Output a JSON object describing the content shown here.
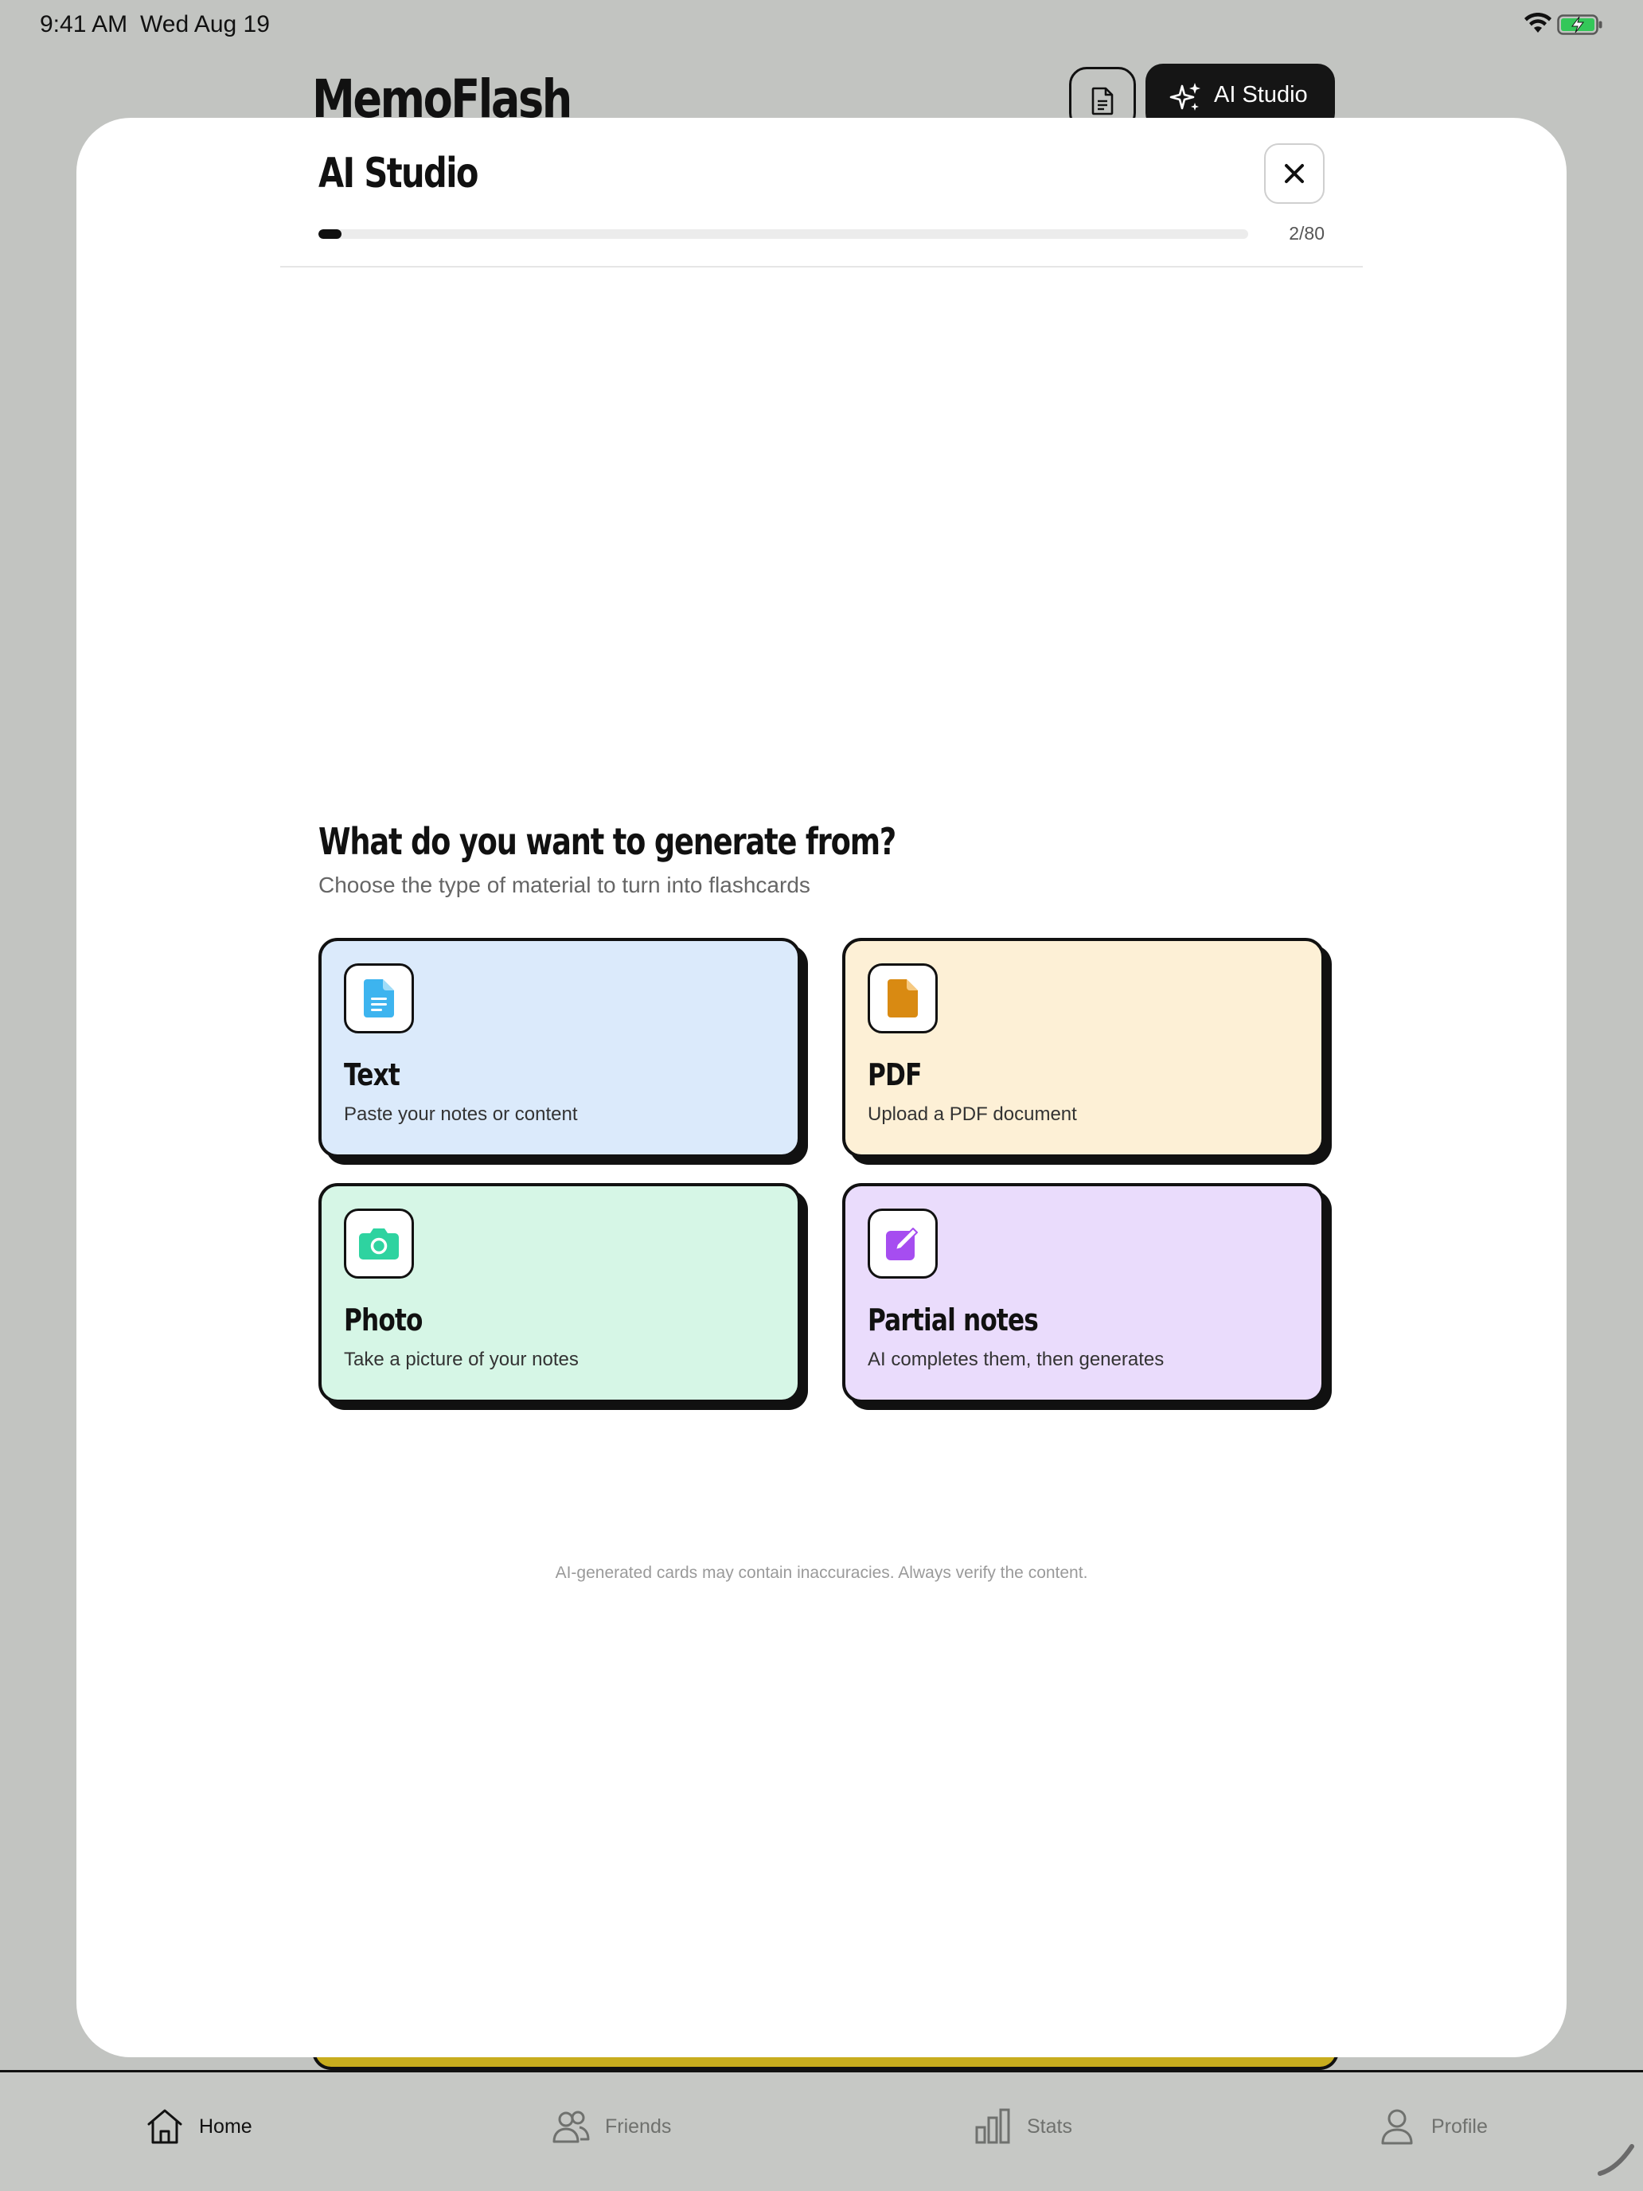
{
  "status_bar": {
    "time": "9:41 AM",
    "date": "Wed Aug 19",
    "wifi_icon": "wifi-icon",
    "battery_icon": "battery-charging-icon",
    "battery_color": "#34c759"
  },
  "header": {
    "app_title": "MemoFlash",
    "notes_icon": "document-icon",
    "ai_studio_label": "AI Studio",
    "ai_studio_icon": "sparkles-icon"
  },
  "modal": {
    "title": "AI Studio",
    "close_icon": "close-icon",
    "progress": {
      "count_text": "2/80",
      "current": 2,
      "total": 80
    },
    "question": "What do you want to generate from?",
    "subtitle": "Choose the type of material to turn into flashcards",
    "options": [
      {
        "title": "Text",
        "description": "Paste your notes or content",
        "icon": "text-document-icon",
        "background": "#dbeafb",
        "icon_color": "#3db4ef"
      },
      {
        "title": "PDF",
        "description": "Upload a PDF document",
        "icon": "pdf-file-icon",
        "background": "#fdf0d6",
        "icon_color": "#d98a12"
      },
      {
        "title": "Photo",
        "description": "Take a picture of your notes",
        "icon": "camera-icon",
        "background": "#d6f6e6",
        "icon_color": "#2ed3a0"
      },
      {
        "title": "Partial notes",
        "description": "AI completes them, then generates",
        "icon": "edit-note-icon",
        "background": "#eadcfc",
        "icon_color": "#a64df0"
      }
    ],
    "disclaimer": "AI-generated cards may contain inaccuracies. Always verify the content."
  },
  "tab_bar": {
    "active": "Home",
    "items": [
      {
        "label": "Home",
        "icon": "home-icon"
      },
      {
        "label": "Friends",
        "icon": "friends-icon"
      },
      {
        "label": "Stats",
        "icon": "stats-icon"
      },
      {
        "label": "Profile",
        "icon": "profile-icon"
      }
    ]
  }
}
